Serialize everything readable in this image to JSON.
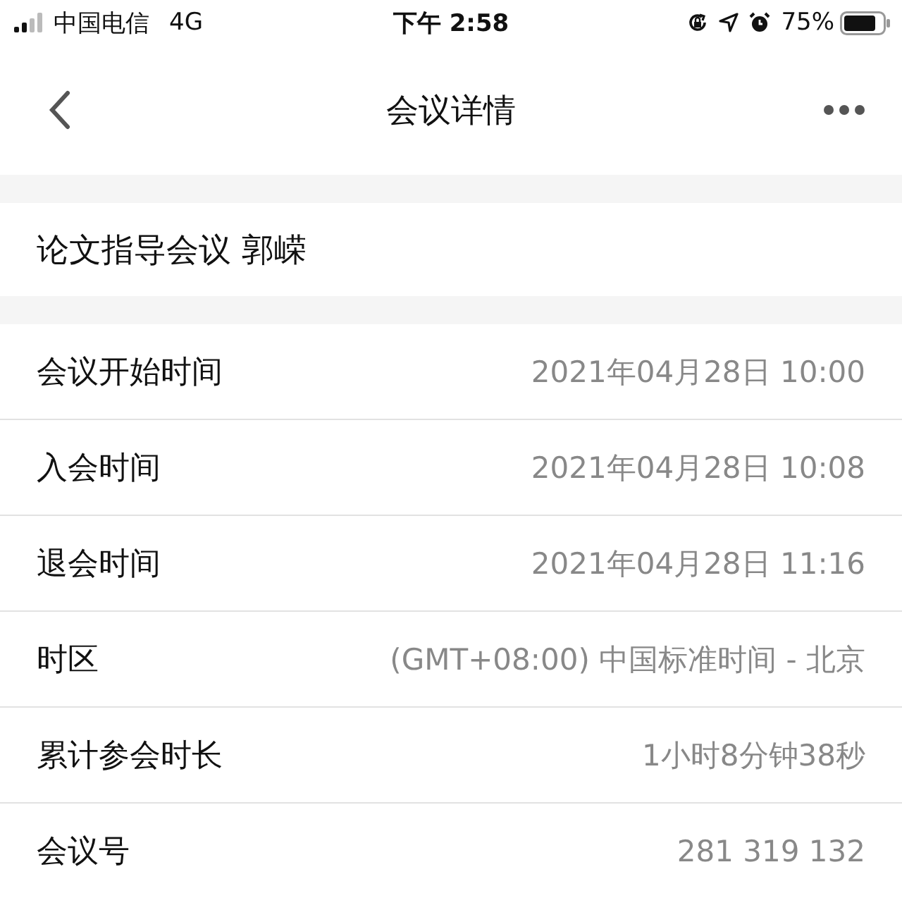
{
  "status_bar": {
    "carrier": "中国电信",
    "network": "4G",
    "time": "下午 2:58",
    "battery": "75%"
  },
  "nav": {
    "title": "会议详情"
  },
  "meeting_title": "论文指导会议 郭嵘",
  "details": [
    {
      "label": "会议开始时间",
      "value": "2021年04月28日 10:00"
    },
    {
      "label": "入会时间",
      "value": "2021年04月28日 10:08"
    },
    {
      "label": "退会时间",
      "value": "2021年04月28日 11:16"
    },
    {
      "label": "时区",
      "value": "(GMT+08:00) 中国标准时间 - 北京"
    },
    {
      "label": "累计参会时长",
      "value": "1小时8分钟38秒"
    },
    {
      "label": "会议号",
      "value": "281 319 132"
    }
  ]
}
